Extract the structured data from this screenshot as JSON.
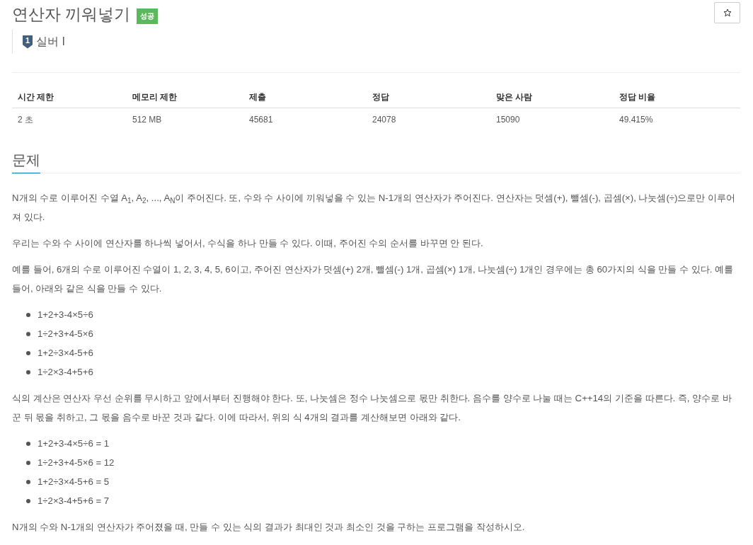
{
  "problem": {
    "title": "연산자 끼워넣기",
    "result": "성공",
    "tier": {
      "number": "1",
      "label": "실버 I"
    }
  },
  "stats_table": {
    "columns": [
      "시간 제한",
      "메모리 제한",
      "제출",
      "정답",
      "맞은 사람",
      "정답 비율"
    ],
    "rows": [
      [
        "2 초",
        "512 MB",
        "45681",
        "24078",
        "15090",
        "49.415%"
      ]
    ]
  },
  "section": {
    "heading": "문제",
    "blocks": [
      {
        "kind": "paragraph",
        "text": "N개의 수로 이루어진 수열 A$_{1}$, A$_{2}$, ..., A$_{N}$이 주어진다. 또, 수와 수 사이에 끼워넣을 수 있는 N-1개의 연산자가 주어진다. 연산자는 덧셈(+), 뺄셈(-), 곱셈(×), 나눗셈(÷)으로만 이루어져 있다."
      },
      {
        "kind": "paragraph",
        "text": "우리는 수와 수 사이에 연산자를 하나씩 넣어서, 수식을 하나 만들 수 있다. 이때, 주어진 수의 순서를 바꾸면 안 된다."
      },
      {
        "kind": "paragraph",
        "text": "예를 들어, 6개의 수로 이루어진 수열이 1, 2, 3, 4, 5, 6이고, 주어진 연산자가 덧셈(+) 2개, 뺄셈(-) 1개, 곱셈(×) 1개, 나눗셈(÷) 1개인 경우에는 총 60가지의 식을 만들 수 있다. 예를 들어, 아래와 같은 식을 만들 수 있다."
      },
      {
        "kind": "list",
        "items": [
          "1+2+3-4×5÷6",
          "1÷2+3+4-5×6",
          "1+2÷3×4-5+6",
          "1÷2×3-4+5+6"
        ]
      },
      {
        "kind": "paragraph",
        "text": "식의 계산은 연산자 우선 순위를 무시하고 앞에서부터 진행해야 한다. 또, 나눗셈은 정수 나눗셈으로 몫만 취한다. 음수를 양수로 나눌 때는 C++14의 기준을 따른다. 즉, 양수로 바꾼 뒤 몫을 취하고, 그 몫을 음수로 바꾼 것과 같다. 이에 따라서, 위의 식 4개의 결과를 계산해보면 아래와 같다."
      },
      {
        "kind": "list",
        "items": [
          "1+2+3-4×5÷6 = 1",
          "1÷2+3+4-5×6 = 12",
          "1+2÷3×4-5+6 = 5",
          "1÷2×3-4+5+6 = 7"
        ]
      },
      {
        "kind": "paragraph",
        "text": "N개의 수와 N-1개의 연산자가 주어졌을 때, 만들 수 있는 식의 결과가 최대인 것과 최소인 것을 구하는 프로그램을 작성하시오."
      }
    ]
  }
}
